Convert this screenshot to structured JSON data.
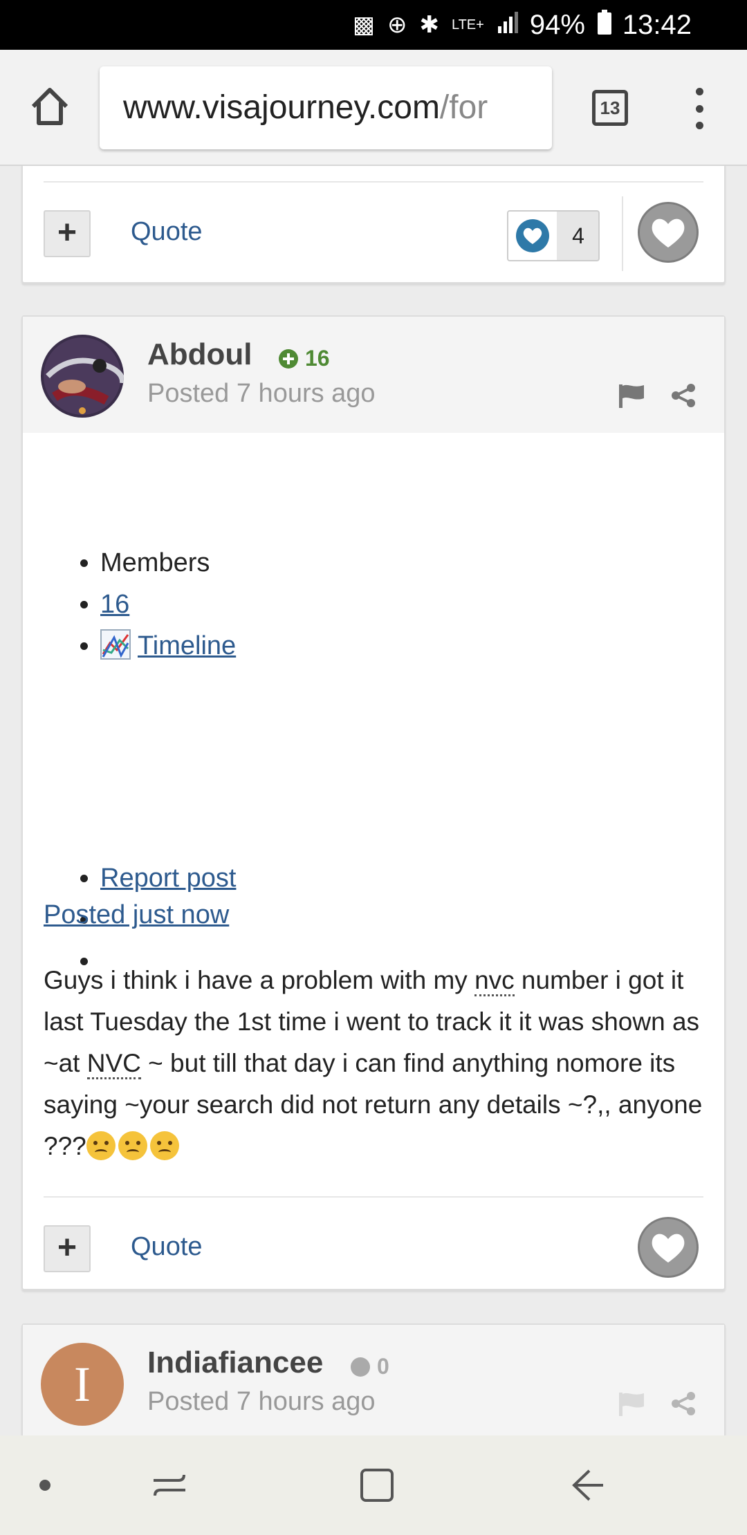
{
  "status_bar": {
    "battery_percent": "94%",
    "time": "13:42",
    "network": "LTE+"
  },
  "browser": {
    "url_domain": "www.visajourney.com",
    "url_path": "/for",
    "tab_count": "13"
  },
  "posts": [
    {
      "quote_label": "Quote",
      "like_count": "4"
    },
    {
      "author": "Abdoul",
      "reputation": "16",
      "posted_relative": "Posted 7 hours ago",
      "meta": {
        "members_label": "Members",
        "count_link": " 16",
        "timeline_link": "Timeline",
        "report_link": "Report post"
      },
      "posted_now_link": "Posted just now",
      "body": {
        "part1": "Guys i think i have a problem with my ",
        "abbr1": "nvc",
        "part2": " number i got it last Tuesday the 1st time i went to track it it was shown as ~at ",
        "abbr2": "NVC",
        "part3": " ~ but till that day i can find anything nomore its saying ~your search did not return any details ~?,, anyone ???"
      },
      "quote_label": "Quote"
    },
    {
      "author": "Indiafiancee",
      "avatar_letter": "I",
      "reputation": "0",
      "posted_relative": "Posted 7 hours ago"
    }
  ],
  "colors": {
    "link": "#2d5a8e",
    "reputation_positive": "#4f8a34",
    "avatar_letter_bg": "#c8885e"
  }
}
